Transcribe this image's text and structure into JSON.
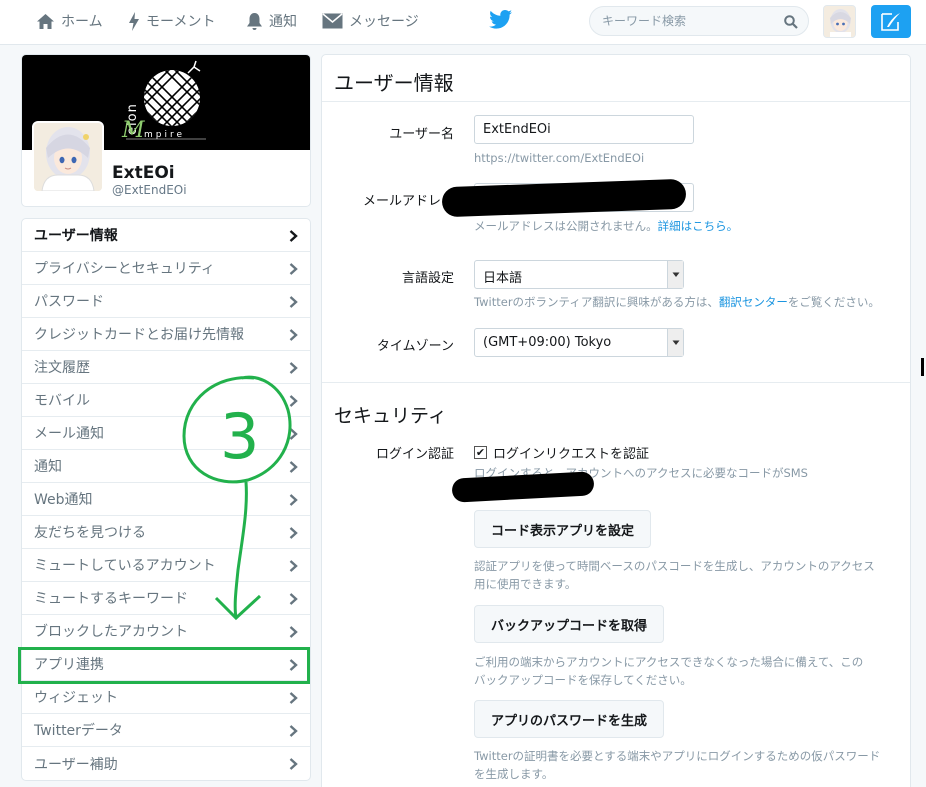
{
  "nav": {
    "home": "ホーム",
    "moments": "モーメント",
    "notifications": "通知",
    "messages": "メッセージ",
    "search_placeholder": "キーワード検索"
  },
  "profile": {
    "banner_text": "Melon Empire",
    "name": "ExtEOi",
    "handle": "@ExtEndEOi"
  },
  "menu": {
    "items": [
      {
        "label": "ユーザー情報",
        "active": true
      },
      {
        "label": "プライバシーとセキュリティ"
      },
      {
        "label": "パスワード"
      },
      {
        "label": "クレジットカードとお届け先情報"
      },
      {
        "label": "注文履歴"
      },
      {
        "label": "モバイル"
      },
      {
        "label": "メール通知"
      },
      {
        "label": "通知"
      },
      {
        "label": "Web通知"
      },
      {
        "label": "友だちを見つける"
      },
      {
        "label": "ミュートしているアカウント"
      },
      {
        "label": "ミュートするキーワード"
      },
      {
        "label": "ブロックしたアカウント"
      },
      {
        "label": "アプリ連携",
        "highlighted": true
      },
      {
        "label": "ウィジェット"
      },
      {
        "label": "Twitterデータ"
      },
      {
        "label": "ユーザー補助"
      }
    ]
  },
  "annotation": {
    "step_number": "3"
  },
  "account": {
    "title": "ユーザー情報",
    "username_label": "ユーザー名",
    "username_value": "ExtEndEOi",
    "profile_url": "https://twitter.com/ExtEndEOi",
    "email_label": "メールアドレス",
    "email_hint": "メールアドレスは公開されません。",
    "email_hint_link": "詳細はこちら。",
    "language_label": "言語設定",
    "language_value": "日本語",
    "language_hint_pre": "Twitterのボランティア翻訳に興味がある方は、",
    "language_hint_link": "翻訳センター",
    "language_hint_post": "をご覧ください。",
    "timezone_label": "タイムゾーン",
    "timezone_value": "(GMT+09:00) Tokyo"
  },
  "security": {
    "title": "セキュリティ",
    "login_verification_label": "ログイン認証",
    "login_verification_checkbox": "ログインリクエストを認証",
    "login_verification_checked": true,
    "login_hint_line1": "ログインすると、アカウントへのアクセスに必要なコードがSMS",
    "login_hint_line2": "送信されます。",
    "setup_app_button": "コード表示アプリを設定",
    "setup_app_hint_line1": "認証アプリを使って時間ベースのパスコードを生成し、アカウントのアクセス",
    "setup_app_hint_line2": "用に使用できます。",
    "backup_button": "バックアップコードを取得",
    "backup_hint_line1": "ご利用の端末からアカウントにアクセスできなくなった場合に備えて、この",
    "backup_hint_line2": "バックアップコードを保存してください。",
    "app_password_button": "アプリのパスワードを生成",
    "app_password_hint_line1": "Twitterの証明書を必要とする端末やアプリにログインするための仮パスワード",
    "app_password_hint_line2": "を生成します。"
  },
  "colors": {
    "twitter_blue": "#1da1f2",
    "annotation_green": "#22b14c"
  }
}
